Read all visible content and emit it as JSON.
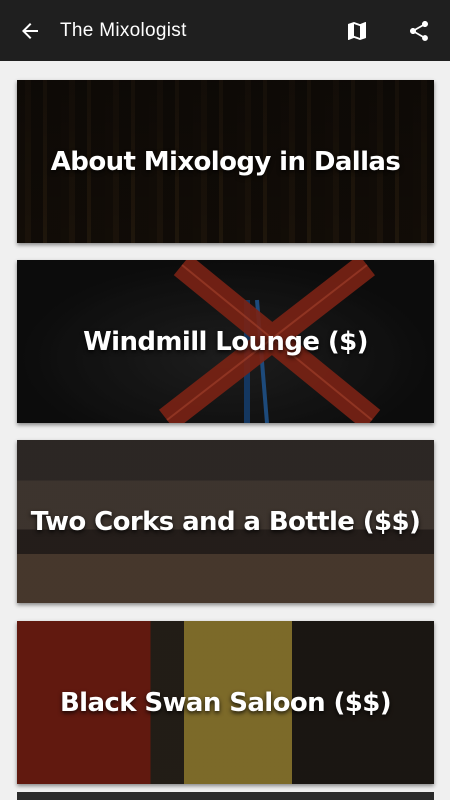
{
  "appbar": {
    "title": "The Mixologist",
    "back_icon": "arrow-left-icon",
    "map_icon": "map-icon",
    "share_icon": "share-icon"
  },
  "cards": [
    {
      "label": "About Mixology in Dallas"
    },
    {
      "label": "Windmill Lounge ($)"
    },
    {
      "label": "Two Corks and a Bottle ($$)"
    },
    {
      "label": "Black Swan Saloon ($$)"
    }
  ]
}
